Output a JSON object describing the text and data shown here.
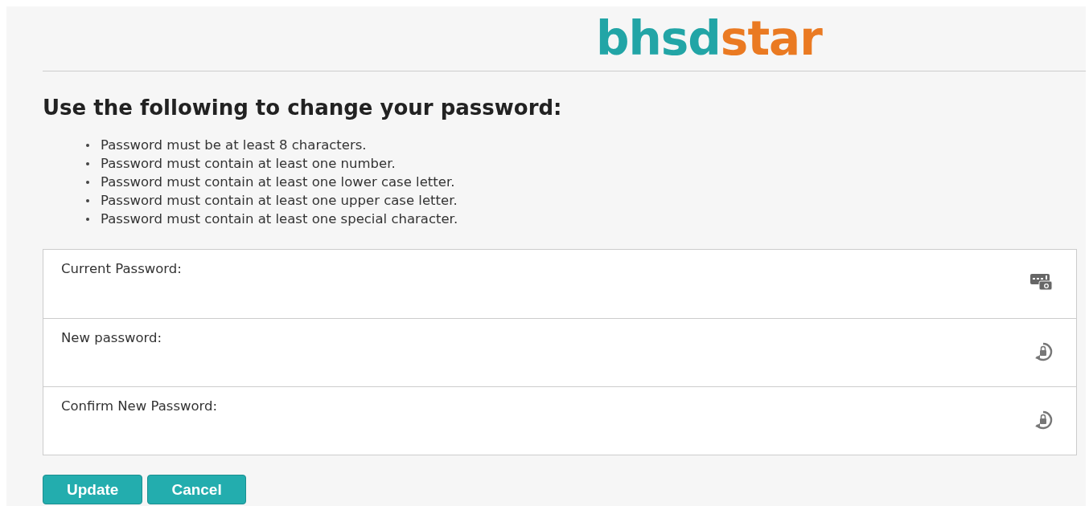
{
  "logo": {
    "first": "bhsd",
    "second": "star"
  },
  "heading": "Use the following to change your password:",
  "rules": [
    "Password must be at least 8 characters.",
    "Password must contain at least one number.",
    "Password must contain at least one lower case letter.",
    "Password must contain at least one upper case letter.",
    "Password must contain at least one special character."
  ],
  "fields": [
    {
      "label": "Current Password:",
      "kind": "keypad"
    },
    {
      "label": "New password:",
      "kind": "lock-cycle"
    },
    {
      "label": "Confirm New Password:",
      "kind": "lock-cycle"
    }
  ],
  "buttons": [
    "Update",
    "Cancel"
  ]
}
